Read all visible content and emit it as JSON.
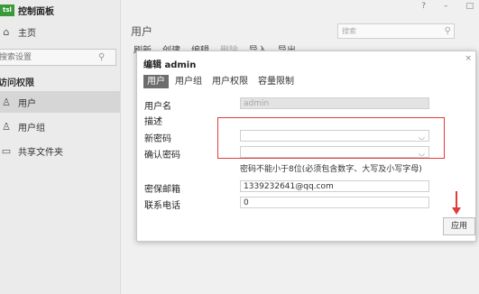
{
  "window": {
    "controls": [
      "?",
      "–",
      "□"
    ]
  },
  "sidebar": {
    "app_title": "控制面板",
    "logo_text": "tsl",
    "home_label": "主页",
    "search_placeholder": "搜索设置",
    "section_title": "访问权限",
    "items": [
      {
        "label": "用户",
        "icon": "user-icon",
        "active": true
      },
      {
        "label": "用户组",
        "icon": "user-group-icon",
        "active": false
      },
      {
        "label": "共享文件夹",
        "icon": "shared-folder-icon",
        "active": false
      }
    ]
  },
  "main": {
    "title": "用户",
    "search_placeholder": "搜索",
    "toolbar": [
      "刷新",
      "创建",
      "编辑",
      "删除",
      "导入",
      "导出"
    ]
  },
  "dialog": {
    "title": "编辑 admin",
    "tabs": [
      {
        "label": "用户",
        "active": true
      },
      {
        "label": "用户组",
        "active": false
      },
      {
        "label": "用户权限",
        "active": false
      },
      {
        "label": "容量限制",
        "active": false
      }
    ],
    "fields": {
      "username_label": "用户名",
      "username_value": "admin",
      "description_label": "描述",
      "description_value": "",
      "new_password_label": "新密码",
      "new_password_value": "",
      "confirm_password_label": "确认密码",
      "confirm_password_value": "",
      "password_hint": "密码不能小于8位(必须包含数字、大写及小写字母)",
      "email_label": "密保邮箱",
      "email_value": "1339232641@qq.com",
      "phone_label": "联系电话",
      "phone_value": "0"
    },
    "apply_label": "应用",
    "close_glyph": "×"
  },
  "colors": {
    "highlight": "#e03c3c",
    "active_tab": "#6d6d6d",
    "logo_green": "#3a9a3a"
  }
}
